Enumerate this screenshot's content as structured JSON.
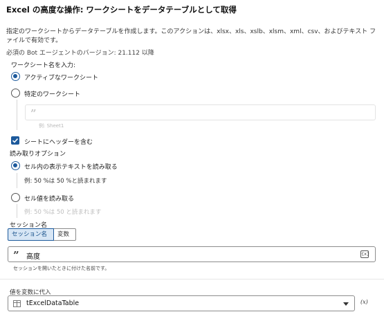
{
  "header": {
    "title": "Excel の高度な操作: ワークシートをデータテーブルとして取得",
    "description": "指定のワークシートからデータテーブルを作成します。このアクションは、xlsx、xls、xslb、xlsm、xml、csv、およびテキスト ファイルで有効です。",
    "requirement": "必須の Bot エージェントのバージョン: 21.112 以降"
  },
  "worksheet": {
    "label": "ワークシート名を入力:",
    "options": [
      {
        "label": "アクティブなワークシート",
        "selected": true
      },
      {
        "label": "特定のワークシート",
        "selected": false
      }
    ],
    "input_hint": "例: Sheet1"
  },
  "header_checkbox": {
    "label": "シートにヘッダーを含む",
    "checked": true
  },
  "read_options": {
    "label": "読み取りオプション",
    "options": [
      {
        "label": "セル内の表示テキストを読み取る",
        "example": "例: 50 %は 50 %と読まれます",
        "selected": true
      },
      {
        "label": "セル値を読み取る",
        "example": "例: 50 %は 50 と読まれます",
        "selected": false
      }
    ]
  },
  "session": {
    "label": "セッション名",
    "toggle": [
      "セッション名",
      "変数"
    ],
    "value": "高度",
    "hint": "セッションを開いたときに付けた名前です。",
    "var_icon": "{x}"
  },
  "assign": {
    "label": "値を変数に代入",
    "value": "tExcelDataTable",
    "var_icon": "(x)"
  },
  "colors": {
    "accent": "#1d5a9c",
    "toggle_active_bg": "#d7e6f5"
  }
}
